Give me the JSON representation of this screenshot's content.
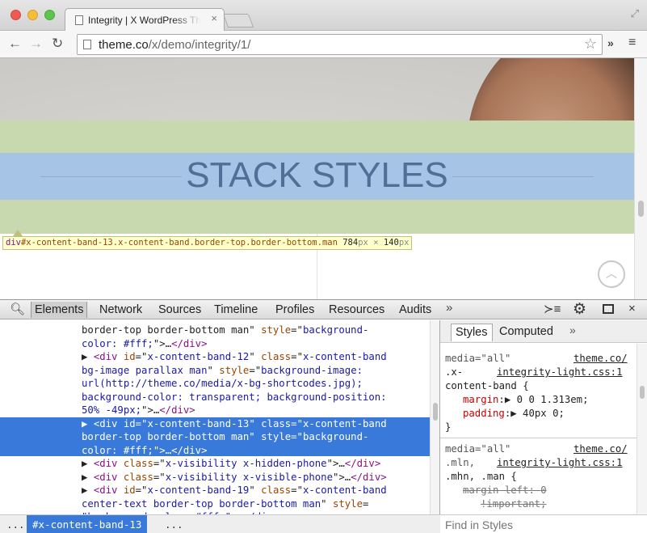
{
  "browser": {
    "tab_title": "Integrity | X WordPress Theme",
    "tab_close": "×",
    "url_domain": "theme.co",
    "url_path": "/x/demo/integrity/1/",
    "ext_label": "»",
    "menu_label": "≡"
  },
  "page": {
    "band_title": "STACK STYLES",
    "scroll_top_label": "︿",
    "tooltip": {
      "tag": "div",
      "selector": "#x-content-band-13.x-content-band.border-top.border-bottom.man",
      "width": "784",
      "height": "140",
      "unit": "px",
      "times": "×"
    }
  },
  "devtools": {
    "tabs": [
      "Elements",
      "Network",
      "Sources",
      "Timeline",
      "Profiles",
      "Resources",
      "Audits"
    ],
    "more_label": "»",
    "elements": {
      "lines": [
        {
          "parts": [
            [
              "plain",
              "border-top border-bottom man\" "
            ],
            [
              "an",
              "style"
            ],
            [
              "plain",
              "=\""
            ],
            [
              "av",
              "background-"
            ]
          ]
        },
        {
          "parts": [
            [
              "av",
              "color: #fff;"
            ],
            [
              "plain",
              "\">…"
            ],
            [
              "t",
              "</div>"
            ]
          ]
        },
        {
          "parts": [
            [
              "plain",
              "▶ "
            ],
            [
              "t",
              "<div"
            ],
            [
              "plain",
              " "
            ],
            [
              "an",
              "id"
            ],
            [
              "plain",
              "=\""
            ],
            [
              "av",
              "x-content-band-12"
            ],
            [
              "plain",
              "\" "
            ],
            [
              "an",
              "class"
            ],
            [
              "plain",
              "=\""
            ],
            [
              "av",
              "x-content-band"
            ]
          ]
        },
        {
          "parts": [
            [
              "av",
              "bg-image parallax man"
            ],
            [
              "plain",
              "\" "
            ],
            [
              "an",
              "style"
            ],
            [
              "plain",
              "=\""
            ],
            [
              "av",
              "background-image:"
            ]
          ]
        },
        {
          "parts": [
            [
              "av",
              "url(http://theme.co/media/x-bg-shortcodes.jpg);"
            ]
          ]
        },
        {
          "parts": [
            [
              "av",
              "background-color: transparent; background-position:"
            ]
          ]
        },
        {
          "parts": [
            [
              "av",
              "50% -49px;"
            ],
            [
              "plain",
              "\">…"
            ],
            [
              "t",
              "</div>"
            ]
          ]
        },
        {
          "parts": [
            [
              "plain",
              "▶ "
            ],
            [
              "t",
              "<div"
            ],
            [
              "plain",
              " "
            ],
            [
              "an",
              "id"
            ],
            [
              "plain",
              "=\""
            ],
            [
              "av",
              "x-content-band-13"
            ],
            [
              "plain",
              "\" "
            ],
            [
              "an",
              "class"
            ],
            [
              "plain",
              "=\""
            ],
            [
              "av",
              "x-content-band"
            ]
          ]
        },
        {
          "parts": [
            [
              "av",
              "border-top border-bottom man"
            ],
            [
              "plain",
              "\" "
            ],
            [
              "an",
              "style"
            ],
            [
              "plain",
              "=\""
            ],
            [
              "av",
              "background-"
            ]
          ]
        },
        {
          "parts": [
            [
              "av",
              "color: #fff;"
            ],
            [
              "plain",
              "\">…"
            ],
            [
              "t",
              "</div>"
            ]
          ]
        },
        {
          "parts": [
            [
              "plain",
              "▶ "
            ],
            [
              "t",
              "<div"
            ],
            [
              "plain",
              " "
            ],
            [
              "an",
              "class"
            ],
            [
              "plain",
              "=\""
            ],
            [
              "av",
              "x-visibility x-hidden-phone"
            ],
            [
              "plain",
              "\">…"
            ],
            [
              "t",
              "</div>"
            ]
          ]
        },
        {
          "parts": [
            [
              "plain",
              "▶ "
            ],
            [
              "t",
              "<div"
            ],
            [
              "plain",
              " "
            ],
            [
              "an",
              "class"
            ],
            [
              "plain",
              "=\""
            ],
            [
              "av",
              "x-visibility x-visible-phone"
            ],
            [
              "plain",
              "\">…"
            ],
            [
              "t",
              "</div>"
            ]
          ]
        },
        {
          "parts": [
            [
              "plain",
              "▶ "
            ],
            [
              "t",
              "<div"
            ],
            [
              "plain",
              " "
            ],
            [
              "an",
              "id"
            ],
            [
              "plain",
              "=\""
            ],
            [
              "av",
              "x-content-band-19"
            ],
            [
              "plain",
              "\" "
            ],
            [
              "an",
              "class"
            ],
            [
              "plain",
              "=\""
            ],
            [
              "av",
              "x-content-band"
            ]
          ]
        },
        {
          "parts": [
            [
              "av",
              "center-text border-top border-bottom man"
            ],
            [
              "plain",
              "\" "
            ],
            [
              "an",
              "style"
            ],
            [
              "plain",
              "="
            ]
          ]
        },
        {
          "parts": [
            [
              "av",
              "\"background-color: #fff;\">…</div>"
            ]
          ]
        }
      ]
    },
    "styles_tabs": [
      "Styles",
      "Computed"
    ],
    "styles_more": "»",
    "styles": {
      "rule1_media": "media=\"all\"",
      "rule1_source1": "theme.co/",
      "rule1_selector1": ".x-",
      "rule1_source2": "integrity-light.css:1",
      "rule1_selector2": "content-band {",
      "rule1_prop1": "margin",
      "rule1_val1": "0 0 1.313em;",
      "rule1_prop2": "padding",
      "rule1_val2": "40px 0;",
      "rule1_close": "}",
      "rule2_media": "media=\"all\"",
      "rule2_source1": "theme.co/",
      "rule2_selector1": ".mln,",
      "rule2_source2": "integrity-light.css:1",
      "rule2_selector2": ".mhn, .man {",
      "rule2_prop1": "margin-left",
      "rule2_val1": "0",
      "rule2_val1b": "!important;"
    },
    "breadcrumb": {
      "prev": "...",
      "current": "#x-content-band-13",
      "next": "..."
    },
    "find_styles_placeholder": "Find in Styles"
  }
}
